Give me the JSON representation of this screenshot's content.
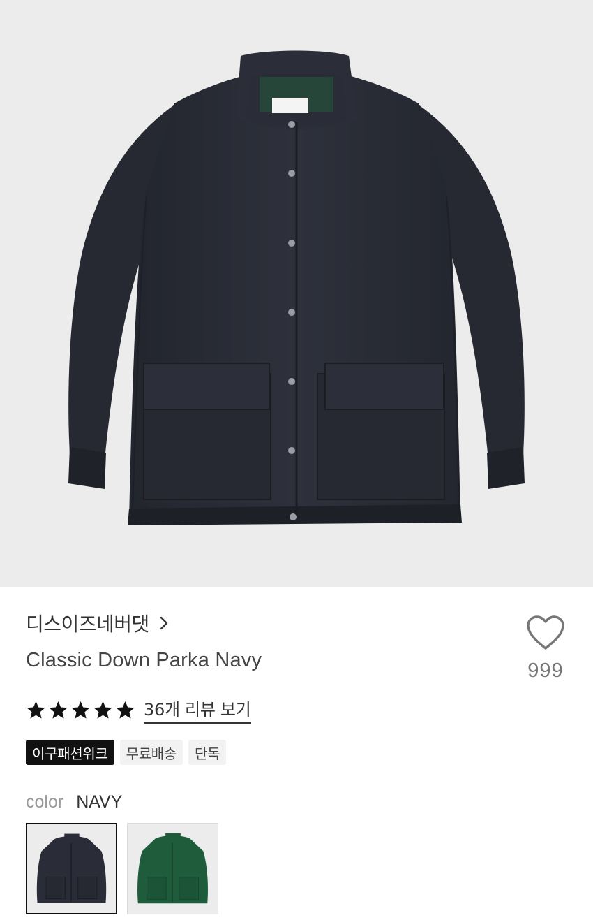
{
  "product": {
    "brand": "디스이즈네버댓",
    "title": "Classic Down Parka Navy",
    "likes": "999",
    "rating": 5,
    "review_link": "36개 리뷰 보기",
    "tags": [
      "이구패션위크",
      "무료배송",
      "단독"
    ],
    "color_label": "color",
    "color_value": "NAVY",
    "swatches": [
      {
        "color": "NAVY",
        "hex": "#2a2d37",
        "selected": true
      },
      {
        "color": "GREEN",
        "hex": "#1e5c3c",
        "selected": false
      }
    ]
  },
  "colors": {
    "jacket_navy": "#2a2d37",
    "jacket_green": "#1e5c3c",
    "hero_bg": "#ececec",
    "tag_dark": "#111111"
  }
}
